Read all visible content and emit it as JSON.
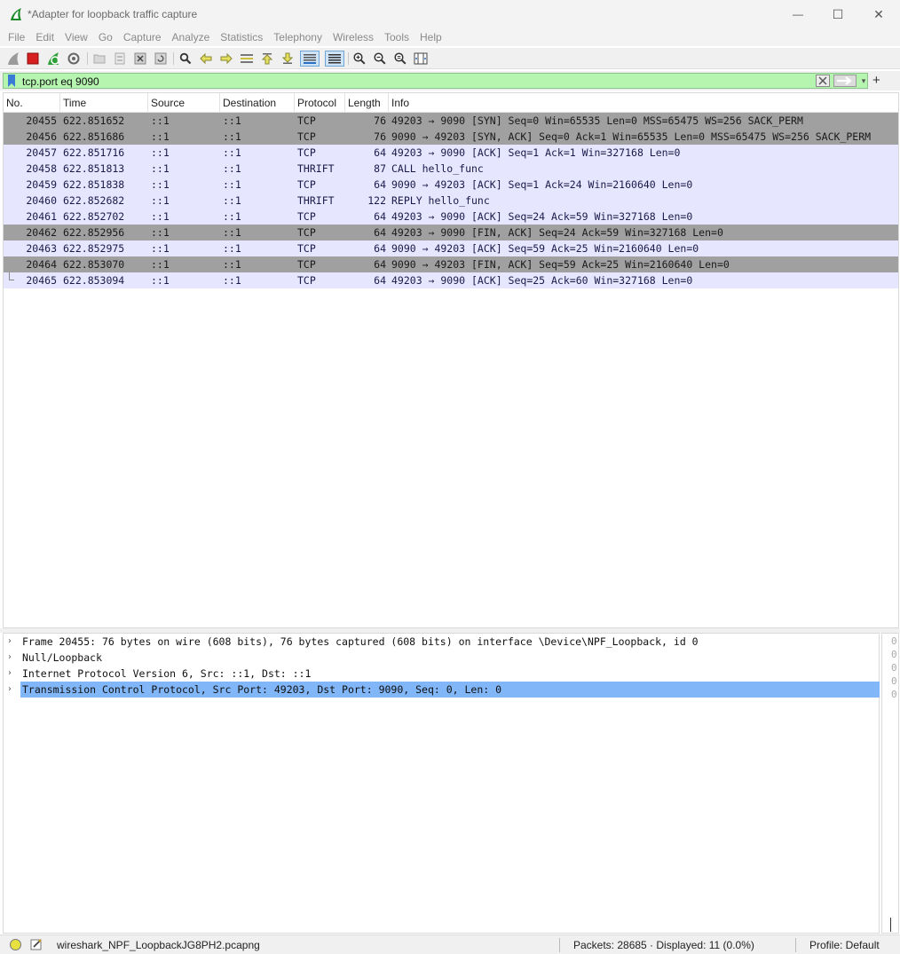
{
  "window": {
    "title": "*Adapter for loopback traffic capture",
    "min_glyph": "—",
    "max_glyph": "☐",
    "close_glyph": "✕"
  },
  "menu": [
    "File",
    "Edit",
    "View",
    "Go",
    "Capture",
    "Analyze",
    "Statistics",
    "Telephony",
    "Wireless",
    "Tools",
    "Help"
  ],
  "filter": {
    "value": "tcp.port eq 9090",
    "add_glyph": "+",
    "dropdown_glyph": "▾"
  },
  "packet_list": {
    "columns": [
      "No.",
      "Time",
      "Source",
      "Destination",
      "Protocol",
      "Length",
      "Info"
    ],
    "rows": [
      {
        "no": "20455",
        "time": "622.851652",
        "src": "::1",
        "dst": "::1",
        "proto": "TCP",
        "len": "76",
        "info": "49203 → 9090 [SYN] Seq=0 Win=65535 Len=0 MSS=65475 WS=256 SACK_PERM",
        "style": "dark"
      },
      {
        "no": "20456",
        "time": "622.851686",
        "src": "::1",
        "dst": "::1",
        "proto": "TCP",
        "len": "76",
        "info": "9090 → 49203 [SYN, ACK] Seq=0 Ack=1 Win=65535 Len=0 MSS=65475 WS=256 SACK_PERM",
        "style": "dark"
      },
      {
        "no": "20457",
        "time": "622.851716",
        "src": "::1",
        "dst": "::1",
        "proto": "TCP",
        "len": "64",
        "info": "49203 → 9090 [ACK] Seq=1 Ack=1 Win=327168 Len=0",
        "style": "light"
      },
      {
        "no": "20458",
        "time": "622.851813",
        "src": "::1",
        "dst": "::1",
        "proto": "THRIFT",
        "len": "87",
        "info": "CALL hello_func",
        "style": "light"
      },
      {
        "no": "20459",
        "time": "622.851838",
        "src": "::1",
        "dst": "::1",
        "proto": "TCP",
        "len": "64",
        "info": "9090 → 49203 [ACK] Seq=1 Ack=24 Win=2160640 Len=0",
        "style": "light"
      },
      {
        "no": "20460",
        "time": "622.852682",
        "src": "::1",
        "dst": "::1",
        "proto": "THRIFT",
        "len": "122",
        "info": "REPLY hello_func",
        "style": "light"
      },
      {
        "no": "20461",
        "time": "622.852702",
        "src": "::1",
        "dst": "::1",
        "proto": "TCP",
        "len": "64",
        "info": "49203 → 9090 [ACK] Seq=24 Ack=59 Win=327168 Len=0",
        "style": "light"
      },
      {
        "no": "20462",
        "time": "622.852956",
        "src": "::1",
        "dst": "::1",
        "proto": "TCP",
        "len": "64",
        "info": "49203 → 9090 [FIN, ACK] Seq=24 Ack=59 Win=327168 Len=0",
        "style": "dark"
      },
      {
        "no": "20463",
        "time": "622.852975",
        "src": "::1",
        "dst": "::1",
        "proto": "TCP",
        "len": "64",
        "info": "9090 → 49203 [ACK] Seq=59 Ack=25 Win=2160640 Len=0",
        "style": "light"
      },
      {
        "no": "20464",
        "time": "622.853070",
        "src": "::1",
        "dst": "::1",
        "proto": "TCP",
        "len": "64",
        "info": "9090 → 49203 [FIN, ACK] Seq=59 Ack=25 Win=2160640 Len=0",
        "style": "dark"
      },
      {
        "no": "20465",
        "time": "622.853094",
        "src": "::1",
        "dst": "::1",
        "proto": "TCP",
        "len": "64",
        "info": "49203 → 9090 [ACK] Seq=25 Ack=60 Win=327168 Len=0",
        "style": "light"
      }
    ]
  },
  "details": {
    "expander_glyph": "›",
    "rows": [
      {
        "text": "Frame 20455: 76 bytes on wire (608 bits), 76 bytes captured (608 bits) on interface \\Device\\NPF_Loopback, id 0",
        "selected": false
      },
      {
        "text": "Null/Loopback",
        "selected": false
      },
      {
        "text": "Internet Protocol Version 6, Src: ::1, Dst: ::1",
        "selected": false
      },
      {
        "text": "Transmission Control Protocol, Src Port: 49203, Dst Port: 9090, Seq: 0, Len: 0",
        "selected": true
      }
    ]
  },
  "bytes_pane": {
    "lines": [
      "0",
      "0",
      "0",
      "0",
      "0"
    ]
  },
  "status": {
    "file": "wireshark_NPF_LoopbackJG8PH2.pcapng",
    "packets": "Packets: 28685 · Displayed: 11 (0.0%)",
    "profile": "Profile: Default"
  },
  "colors": {
    "filter_valid": "#b5f5b0",
    "row_dark": "#a0a0a0",
    "row_light": "#e7e6ff",
    "selected_detail": "#81b6f8"
  }
}
